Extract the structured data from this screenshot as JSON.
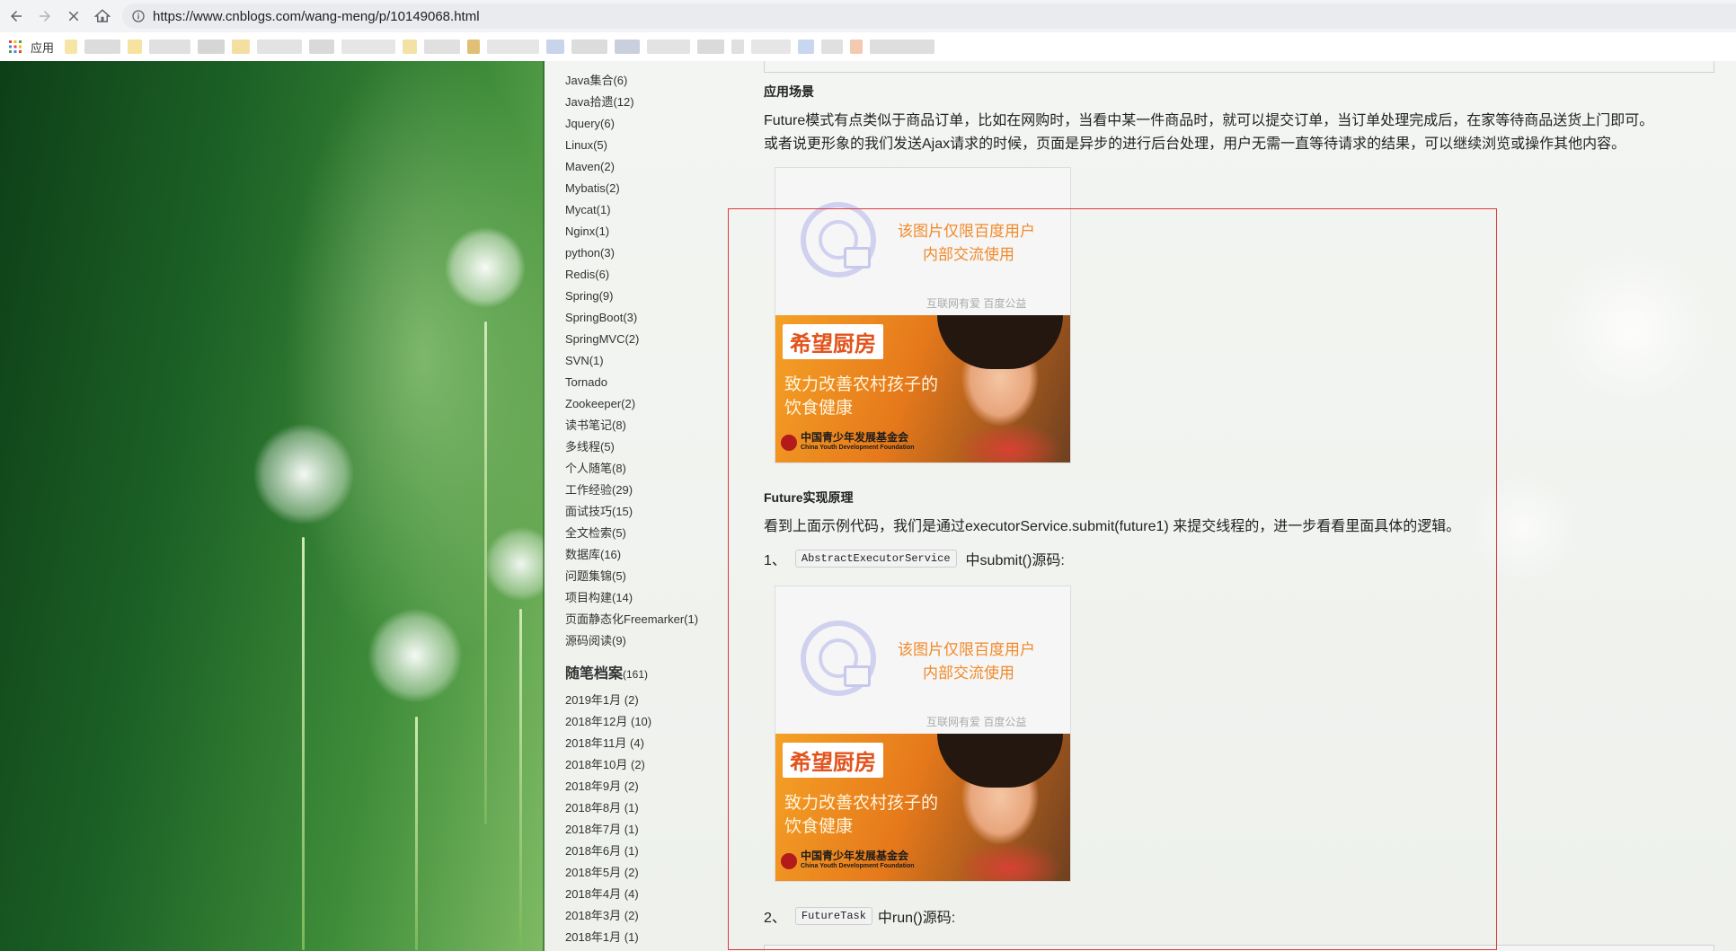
{
  "browser": {
    "url": "https://www.cnblogs.com/wang-meng/p/10149068.html",
    "bookmarks": {
      "apps_label": "应用"
    }
  },
  "sidebar": {
    "categories": [
      "Java集合(6)",
      "Java拾遗(12)",
      "Jquery(6)",
      "Linux(5)",
      "Maven(2)",
      "Mybatis(2)",
      "Mycat(1)",
      "Nginx(1)",
      "python(3)",
      "Redis(6)",
      "Spring(9)",
      "SpringBoot(3)",
      "SpringMVC(2)",
      "SVN(1)",
      "Tornado",
      "Zookeeper(2)",
      "读书笔记(8)",
      "多线程(5)",
      "个人随笔(8)",
      "工作经验(29)",
      "面试技巧(15)",
      "全文检索(5)",
      "数据库(16)",
      "问题集锦(5)",
      "项目构建(14)",
      "页面静态化Freemarker(1)",
      "源码阅读(9)"
    ],
    "archive": {
      "title": "随笔档案",
      "count": "(161)",
      "items": [
        "2019年1月 (2)",
        "2018年12月 (10)",
        "2018年11月 (4)",
        "2018年10月 (2)",
        "2018年9月 (2)",
        "2018年8月 (1)",
        "2018年7月 (1)",
        "2018年6月 (1)",
        "2018年5月 (2)",
        "2018年4月 (4)",
        "2018年3月 (2)",
        "2018年1月 (1)"
      ]
    }
  },
  "article": {
    "section1_title": "应用场景",
    "section1_para1": "Future模式有点类似于商品订单，比如在网购时，当看中某一件商品时，就可以提交订单，当订单处理完成后，在家等待商品送货上门即可。",
    "section1_para2": "或者说更形象的我们发送Ajax请求的时候，页面是异步的进行后台处理，用户无需一直等待请求的结果，可以继续浏览或操作其他内容。",
    "section2_title": "Future实现原理",
    "section2_para": "看到上面示例代码，我们是通过executorService.submit(future1) 来提交线程的，进一步看看里面具体的逻辑。",
    "step1": {
      "num": "1、",
      "code": "AbstractExecutorService",
      "text": "中submit()源码:"
    },
    "step2": {
      "num": "2、",
      "code": "FutureTask",
      "text": "中run()源码:"
    }
  },
  "placeholder_image": {
    "line1": "该图片仅限百度用户",
    "line2": "内部交流使用",
    "footer": "互联网有爱  百度公益",
    "title": "希望厨房",
    "sub1": "致力改善农村孩子的",
    "sub2": "饮食健康",
    "foundation": "中国青少年发展基金会",
    "foundation_en": "China Youth Development Foundation"
  },
  "colors": {
    "highlight_border": "#e0393e",
    "placeholder_text": "#f08a2a"
  }
}
